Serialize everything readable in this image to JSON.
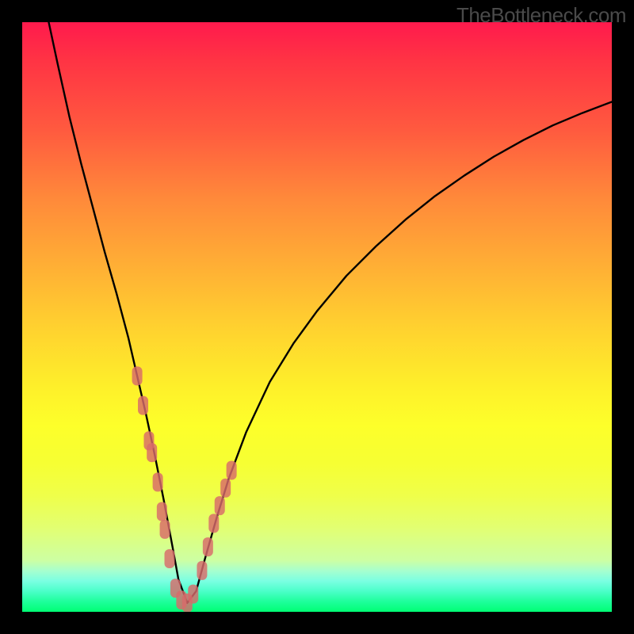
{
  "attribution": "TheBottleneck.com",
  "chart_data": {
    "type": "line",
    "title": "",
    "xlabel": "",
    "ylabel": "",
    "xlim": [
      0,
      100
    ],
    "ylim": [
      0,
      100
    ],
    "grid": false,
    "legend": false,
    "series": [
      {
        "name": "bottleneck-curve",
        "color": "#000000",
        "x": [
          4.5,
          6,
          8,
          10,
          12,
          14,
          16,
          18,
          19.5,
          21,
          22.5,
          24,
          25.5,
          26.5,
          28,
          29.5,
          31,
          33,
          35,
          38,
          42,
          46,
          50,
          55,
          60,
          65,
          70,
          75,
          80,
          85,
          90,
          95,
          100
        ],
        "y": [
          100,
          93,
          84,
          76,
          68.5,
          61,
          54,
          46.5,
          40,
          33.5,
          26.5,
          19,
          11,
          5.5,
          1.5,
          3.5,
          9,
          16,
          22.5,
          30.5,
          39,
          45.5,
          51,
          57,
          62,
          66.5,
          70.5,
          74,
          77.2,
          80,
          82.5,
          84.6,
          86.5
        ]
      },
      {
        "name": "highlighted-points",
        "color": "#d86a6a",
        "type": "scatter",
        "x": [
          19.5,
          20.5,
          21.5,
          22.0,
          23.0,
          23.7,
          24.2,
          25.0,
          26.0,
          27.0,
          28.0,
          29.0,
          30.5,
          31.5,
          32.5,
          33.5,
          34.5,
          35.5
        ],
        "y": [
          40,
          35,
          29,
          27,
          22,
          17,
          14,
          9,
          4,
          2,
          1.5,
          3,
          7,
          11,
          15,
          18,
          21,
          24
        ]
      }
    ],
    "background_gradient": {
      "type": "vertical",
      "stops": [
        {
          "pos": 0.0,
          "color": "#ff1a4d"
        },
        {
          "pos": 0.2,
          "color": "#ff5a3f"
        },
        {
          "pos": 0.45,
          "color": "#ffae35"
        },
        {
          "pos": 0.68,
          "color": "#fef02a"
        },
        {
          "pos": 0.85,
          "color": "#efff4a"
        },
        {
          "pos": 0.93,
          "color": "#a7ffce"
        },
        {
          "pos": 1.0,
          "color": "#00ff74"
        }
      ]
    }
  }
}
